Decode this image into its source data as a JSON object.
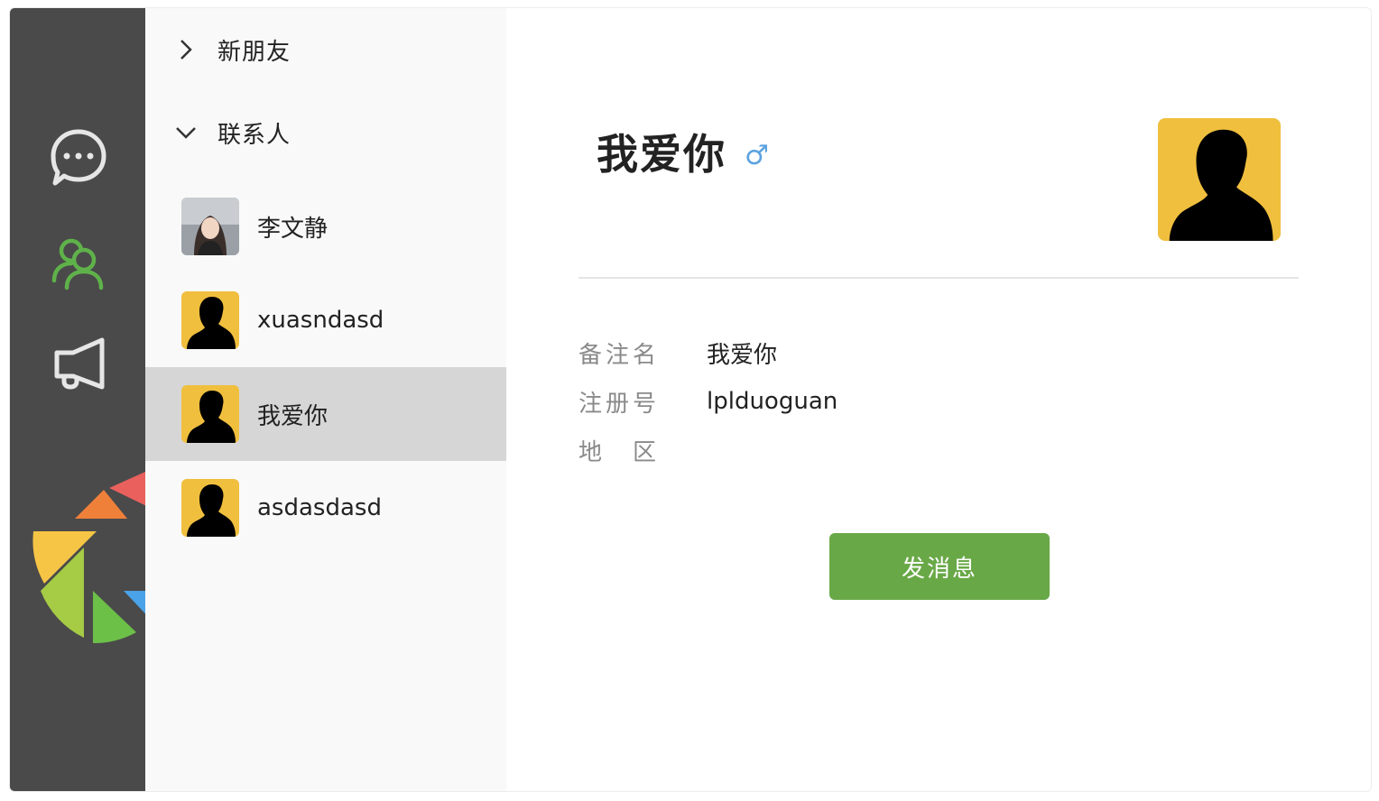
{
  "sidebar": {
    "items": [
      {
        "name": "chat-bubble-icon",
        "active": false
      },
      {
        "name": "contacts-icon",
        "active": true
      },
      {
        "name": "megaphone-icon",
        "active": false
      }
    ],
    "logo": "app-logo",
    "colors": {
      "rail_bg": "#4a4a4a",
      "active": "#5fb24a",
      "inactive": "#e6e6e6"
    }
  },
  "contact_list": {
    "new_friends_label": "新朋友",
    "contacts_label": "联系人",
    "contacts": [
      {
        "name": "李文静",
        "avatar": "photo-avatar"
      },
      {
        "name": "xuasndasd",
        "avatar": "silhouette-avatar"
      },
      {
        "name": "我爱你",
        "avatar": "silhouette-avatar",
        "selected": true
      },
      {
        "name": "asdasdasd",
        "avatar": "silhouette-avatar"
      }
    ]
  },
  "detail": {
    "name": "我爱你",
    "gender_symbol": "♂",
    "fields": [
      {
        "label": "备注名",
        "value": "我爱你"
      },
      {
        "label": "注册号",
        "value": "lplduoguan"
      },
      {
        "label": "地　区",
        "value": ""
      }
    ],
    "send_button_label": "发消息",
    "colors": {
      "button": "#69a847",
      "gender": "#5aa2e0",
      "avatar_bg": "#f0bf3e"
    }
  }
}
